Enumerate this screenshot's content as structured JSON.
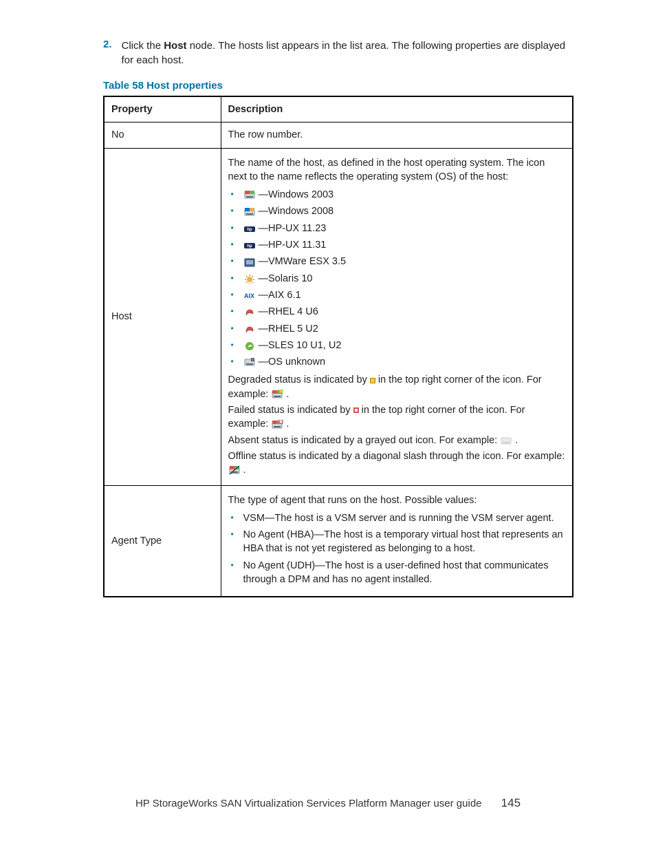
{
  "step": {
    "number": "2.",
    "before_bold": "Click the ",
    "bold": "Host",
    "after_bold": " node. The hosts list appears in the list area. The following properties are displayed for each host."
  },
  "table_caption": "Table 58 Host properties",
  "headers": {
    "property": "Property",
    "description": "Description"
  },
  "row_no": {
    "prop": "No",
    "desc": "The row number."
  },
  "row_host": {
    "prop": "Host",
    "intro": "The name of the host, as defined in the host operating system. The icon next to the name reflects the operating system (OS) of the host:",
    "os_items": [
      {
        "label": "—Windows 2003",
        "icon": "win2003"
      },
      {
        "label": "—Windows 2008",
        "icon": "win2008"
      },
      {
        "label": "—HP-UX 11.23",
        "icon": "hpux"
      },
      {
        "label": "—HP-UX 11.31",
        "icon": "hpux"
      },
      {
        "label": "—VMWare ESX 3.5",
        "icon": "vmw"
      },
      {
        "label": "—Solaris 10",
        "icon": "solaris"
      },
      {
        "label": "—AIX 6.1",
        "icon": "aix"
      },
      {
        "label": "—RHEL 4 U6",
        "icon": "rhel"
      },
      {
        "label": "—RHEL 5 U2",
        "icon": "rhel"
      },
      {
        "label": "—SLES 10 U1, U2",
        "icon": "sles"
      },
      {
        "label": "—OS unknown",
        "icon": "unknown"
      }
    ],
    "status_degraded_a": "Degraded status is indicated by ",
    "status_degraded_b": " in the top right corner of the icon. For example: ",
    "status_degraded_c": " .",
    "status_failed_a": "Failed status is indicated by ",
    "status_failed_b": " in the top right corner of the icon. For example: ",
    "status_failed_c": " .",
    "status_absent_a": "Absent status is indicated by a grayed out icon. For example: ",
    "status_absent_b": " .",
    "status_offline_a": "Offline status is indicated by a diagonal slash through the icon. For example: ",
    "status_offline_b": " ."
  },
  "row_agent": {
    "prop": "Agent Type",
    "intro": "The type of agent that runs on the host. Possible values:",
    "items": [
      "VSM—The host is a VSM server and is running the VSM server agent.",
      "No Agent (HBA)—The host is a temporary virtual host that represents an HBA that is not yet registered as belonging to a host.",
      "No Agent (UDH)—The host is a user-defined host that communicates through a DPM and has no agent installed."
    ]
  },
  "footer": {
    "title": "HP StorageWorks SAN Virtualization Services Platform Manager user guide",
    "page": "145"
  }
}
